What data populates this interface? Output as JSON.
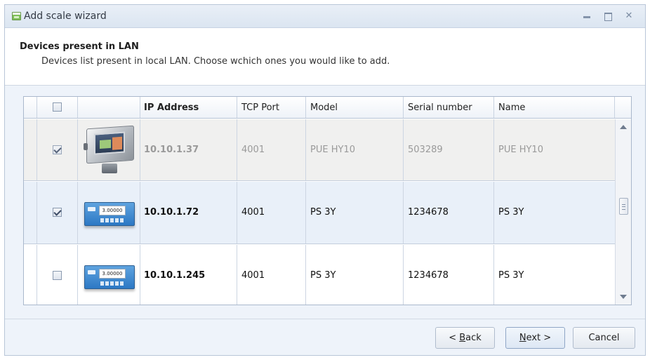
{
  "window": {
    "title": "Add scale wizard"
  },
  "header": {
    "title": "Devices present in LAN",
    "description": "Devices list present in local LAN. Choose wchich ones you would like to add."
  },
  "table": {
    "select_all_checked": false,
    "columns": {
      "ip": "IP Address",
      "port": "TCP Port",
      "model": "Model",
      "serial": "Serial number",
      "name": "Name"
    },
    "rows": [
      {
        "checked": true,
        "disabled": true,
        "device_image": "terminal-scale-image",
        "ip": "10.10.1.37",
        "port": "4001",
        "model": "PUE HY10",
        "serial": "503289",
        "name": "PUE HY10"
      },
      {
        "checked": true,
        "disabled": false,
        "device_image": "panel-scale-image",
        "display": "3.00000",
        "ip": "10.10.1.72",
        "port": "4001",
        "model": "PS 3Y",
        "serial": "1234678",
        "name": "PS 3Y"
      },
      {
        "checked": false,
        "disabled": false,
        "device_image": "panel-scale-image",
        "display": "3.00000",
        "ip": "10.10.1.245",
        "port": "4001",
        "model": "PS 3Y",
        "serial": "1234678",
        "name": "PS 3Y"
      }
    ]
  },
  "buttons": {
    "back_prefix": "< ",
    "back_mnemonic": "B",
    "back_rest": "ack",
    "next_mnemonic": "N",
    "next_rest": "ext >",
    "cancel": "Cancel"
  },
  "colors": {
    "selected_row": "#e9f0f9",
    "disabled_row": "#f0f0ef",
    "border": "#aab8cc"
  }
}
